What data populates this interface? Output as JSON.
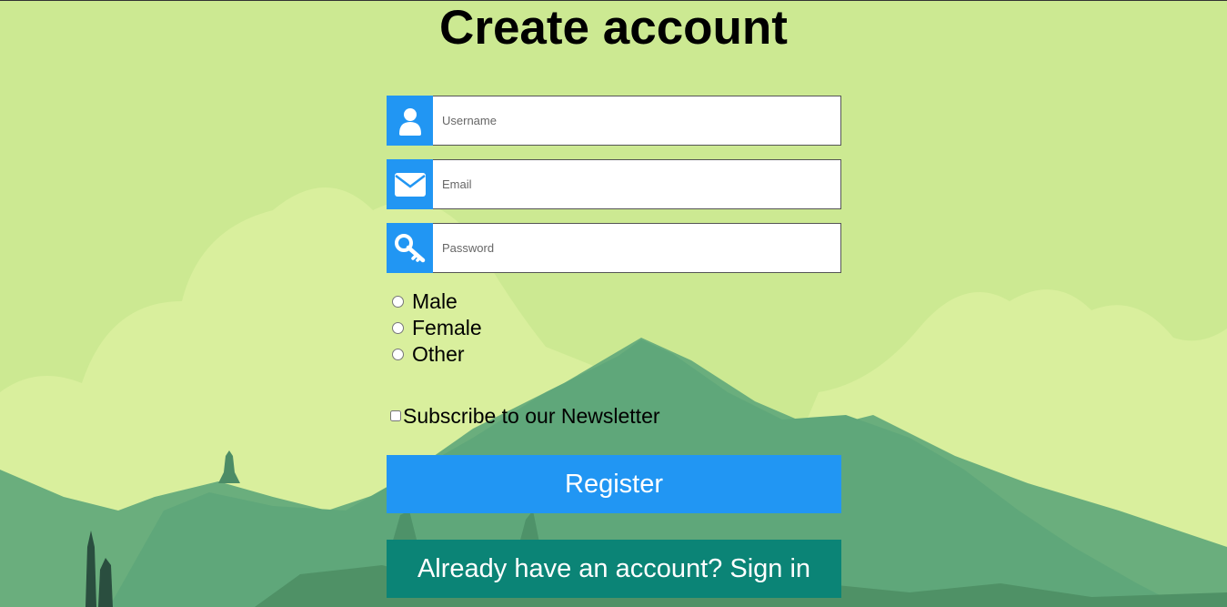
{
  "form": {
    "title": "Create account",
    "username": {
      "placeholder": "Username",
      "icon": "user-icon"
    },
    "email": {
      "placeholder": "Email",
      "icon": "envelope-icon"
    },
    "password": {
      "placeholder": "Password",
      "icon": "key-icon"
    },
    "gender_options": [
      "Male",
      "Female",
      "Other"
    ],
    "newsletter_label": "Subscribe to our Newsletter",
    "register_label": "Register",
    "signin_label": "Already have an account? Sign in"
  },
  "colors": {
    "accent": "#2196f3",
    "signin_button": "#0b8476",
    "background": "#cde992"
  }
}
